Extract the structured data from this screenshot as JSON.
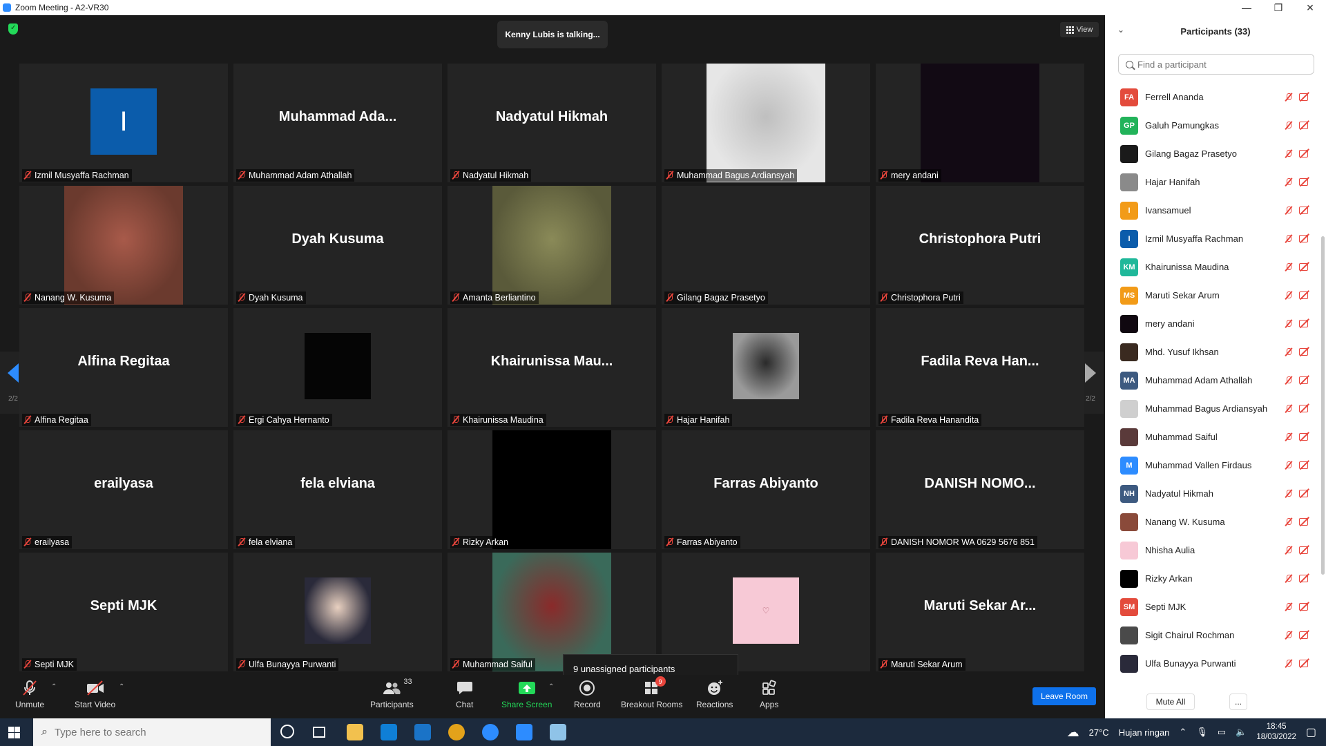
{
  "window": {
    "title": "Zoom Meeting - A2-VR30",
    "minimize": "—",
    "maximize": "❐",
    "close": "✕"
  },
  "meeting": {
    "talking_banner": "Kenny Lubis is talking...",
    "view_label": "View",
    "page_indicator_left": "2/2",
    "page_indicator_right": "2/2",
    "unassigned_tooltip": "9 unassigned participants"
  },
  "tiles": [
    {
      "name": "Izmil Musyaffa Rachman",
      "big": "",
      "pic": {
        "kind": "initial",
        "size": "small",
        "bg": "#0b5cab",
        "text": "I"
      }
    },
    {
      "name": "Muhammad Adam Athallah",
      "big": "Muhammad  Ada...",
      "pic": null
    },
    {
      "name": "Nadyatul Hikmah",
      "big": "Nadyatul Hikmah",
      "pic": null
    },
    {
      "name": "Muhammad Bagus Ardiansyah",
      "big": "",
      "pic": {
        "kind": "photo",
        "size": "full",
        "bg": "#e6e6e6",
        "fg": "#bfbfbf"
      }
    },
    {
      "name": "mery andani",
      "big": "",
      "pic": {
        "kind": "photo",
        "size": "full",
        "bg": "#120a14",
        "fg": "#120a14"
      }
    },
    {
      "name": "Nanang W. Kusuma",
      "big": "",
      "pic": {
        "kind": "photo",
        "size": "full",
        "bg": "#6b3a2e",
        "fg": "#a85a4a"
      }
    },
    {
      "name": "Dyah Kusuma",
      "big": "Dyah Kusuma",
      "pic": null
    },
    {
      "name": "Amanta Berliantino",
      "big": "",
      "pic": {
        "kind": "photo",
        "size": "full",
        "bg": "#5a5a3a",
        "fg": "#8a8a58"
      }
    },
    {
      "name": "Gilang Bagaz Prasetyo",
      "big": "",
      "pic": null
    },
    {
      "name": "Christophora Putri",
      "big": "Christophora Putri",
      "pic": null
    },
    {
      "name": "Alfina Regitaa",
      "big": "Alfina Regitaa",
      "pic": null
    },
    {
      "name": "Ergi Cahya Hernanto",
      "big": "",
      "pic": {
        "kind": "photo",
        "size": "small",
        "bg": "#050505",
        "fg": "#050505"
      }
    },
    {
      "name": "Khairunissa Maudina",
      "big": "Khairunissa  Mau...",
      "pic": null
    },
    {
      "name": "Hajar Hanifah",
      "big": "",
      "pic": {
        "kind": "photo",
        "size": "small",
        "bg": "#9a9a9a",
        "fg": "#2a2a2a"
      }
    },
    {
      "name": "Fadila Reva Hanandita",
      "big": "Fadila Reva Han...",
      "pic": null
    },
    {
      "name": "erailyasa",
      "big": "erailyasa",
      "pic": null
    },
    {
      "name": "fela elviana",
      "big": "fela elviana",
      "pic": null
    },
    {
      "name": "Rizky Arkan",
      "big": "",
      "pic": {
        "kind": "photo",
        "size": "full",
        "bg": "#000000",
        "fg": "#000000"
      }
    },
    {
      "name": "Farras Abiyanto",
      "big": "Farras Abiyanto",
      "pic": null
    },
    {
      "name": "DANISH NOMOR WA 0629 5676 851",
      "big": "DANISH  NOMO...",
      "pic": null
    },
    {
      "name": "Septi MJK",
      "big": "Septi MJK",
      "pic": null
    },
    {
      "name": "Ulfa Bunayya Purwanti",
      "big": "",
      "pic": {
        "kind": "photo",
        "size": "small",
        "bg": "#2a2a3a",
        "fg": "#e8d0c0"
      }
    },
    {
      "name": "Muhammad Saiful",
      "big": "",
      "pic": {
        "kind": "photo",
        "size": "full",
        "bg": "#3a6a5a",
        "fg": "#8a2a2a"
      }
    },
    {
      "name": "",
      "big": "",
      "pic": {
        "kind": "initial",
        "size": "small",
        "bg": "#f7c9d6",
        "text": "♡"
      }
    },
    {
      "name": "Maruti Sekar Arum",
      "big": "Maruti Sekar Ar...",
      "pic": null
    }
  ],
  "toolbar": {
    "unmute": "Unmute",
    "start_video": "Start Video",
    "participants": "Participants",
    "participants_count": "33",
    "chat": "Chat",
    "share_screen": "Share Screen",
    "record": "Record",
    "breakout_rooms": "Breakout Rooms",
    "breakout_badge": "9",
    "reactions": "Reactions",
    "apps": "Apps",
    "leave": "Leave Room"
  },
  "panel": {
    "title": "Participants (33)",
    "search_placeholder": "Find a participant",
    "mute_all": "Mute All",
    "more": "...",
    "participants": [
      {
        "name": "Ferrell Ananda",
        "initials": "FA",
        "color": "#e34b3c"
      },
      {
        "name": "Galuh Pamungkas",
        "initials": "GP",
        "color": "#22b35a"
      },
      {
        "name": "Gilang Bagaz Prasetyo",
        "initials": "",
        "color": "#1a1a1a"
      },
      {
        "name": "Hajar Hanifah",
        "initials": "",
        "color": "#8a8a8a"
      },
      {
        "name": "Ivansamuel",
        "initials": "I",
        "color": "#f29b18"
      },
      {
        "name": "Izmil Musyaffa Rachman",
        "initials": "I",
        "color": "#0b5cab"
      },
      {
        "name": "Khairunissa Maudina",
        "initials": "KM",
        "color": "#1fb89a"
      },
      {
        "name": "Maruti Sekar Arum",
        "initials": "MS",
        "color": "#f29b18"
      },
      {
        "name": "mery andani",
        "initials": "",
        "color": "#100810"
      },
      {
        "name": "Mhd. Yusuf Ikhsan",
        "initials": "",
        "color": "#3a2a20"
      },
      {
        "name": "Muhammad Adam Athallah",
        "initials": "MA",
        "color": "#3d5a80"
      },
      {
        "name": "Muhammad Bagus Ardiansyah",
        "initials": "",
        "color": "#cfcfcf"
      },
      {
        "name": "Muhammad Saiful",
        "initials": "",
        "color": "#5a3a3a"
      },
      {
        "name": "Muhammad Vallen Firdaus",
        "initials": "M",
        "color": "#2d8cff"
      },
      {
        "name": "Nadyatul Hikmah",
        "initials": "NH",
        "color": "#3d5a80"
      },
      {
        "name": "Nanang W. Kusuma",
        "initials": "",
        "color": "#8a4a3a"
      },
      {
        "name": "Nhisha Aulia",
        "initials": "",
        "color": "#f7c9d6"
      },
      {
        "name": "Rizky Arkan",
        "initials": "",
        "color": "#000000"
      },
      {
        "name": "Septi MJK",
        "initials": "SM",
        "color": "#e34b3c"
      },
      {
        "name": "Sigit Chairul Rochman",
        "initials": "",
        "color": "#4a4a4a"
      },
      {
        "name": "Ulfa Bunayya Purwanti",
        "initials": "",
        "color": "#2a2a3a"
      }
    ]
  },
  "taskbar": {
    "search_placeholder": "Type here to search",
    "weather_temp": "27°C",
    "weather_text": "Hujan ringan",
    "time": "18:45",
    "date": "18/03/2022"
  }
}
